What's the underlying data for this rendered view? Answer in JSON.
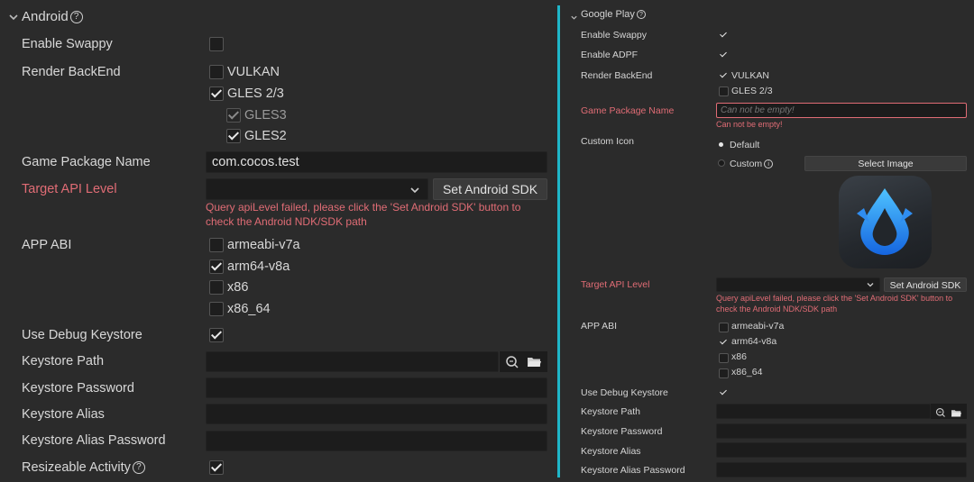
{
  "left": {
    "section_title": "Android",
    "enable_swappy_label": "Enable Swappy",
    "render_backend_label": "Render BackEnd",
    "render_options": [
      "VULKAN",
      "GLES 2/3",
      "GLES3",
      "GLES2"
    ],
    "game_package_label": "Game Package Name",
    "game_package_value": "com.cocos.test",
    "target_api_label": "Target API Level",
    "set_sdk_label": "Set Android SDK",
    "api_error_line1": "Query apiLevel failed, please click the 'Set Android SDK' button to",
    "api_error_line2": "check the Android NDK/SDK path",
    "app_abi_label": "APP ABI",
    "abi_options": [
      "armeabi-v7a",
      "arm64-v8a",
      "x86",
      "x86_64"
    ],
    "use_debug_keystore_label": "Use Debug Keystore",
    "keystore_path_label": "Keystore Path",
    "keystore_password_label": "Keystore Password",
    "keystore_alias_label": "Keystore Alias",
    "keystore_alias_password_label": "Keystore Alias Password",
    "resizeable_activity_label": "Resizeable Activity"
  },
  "right": {
    "section_title": "Google Play",
    "enable_swappy_label": "Enable Swappy",
    "enable_adpf_label": "Enable ADPF",
    "render_backend_label": "Render BackEnd",
    "render_options": [
      "VULKAN",
      "GLES 2/3"
    ],
    "game_package_label": "Game Package Name",
    "game_package_placeholder": "Can not be empty!",
    "game_package_error": "Can not be empty!",
    "custom_icon_label": "Custom Icon",
    "icon_default_label": "Default",
    "icon_custom_label": "Custom",
    "select_image_label": "Select Image",
    "target_api_label": "Target API Level",
    "set_sdk_label": "Set Android SDK",
    "api_error_line1": "Query apiLevel failed, please click the 'Set Android SDK' button to",
    "api_error_line2": "check the Android NDK/SDK path",
    "app_abi_label": "APP ABI",
    "abi_options": [
      "armeabi-v7a",
      "arm64-v8a",
      "x86",
      "x86_64"
    ],
    "use_debug_keystore_label": "Use Debug Keystore",
    "keystore_path_label": "Keystore Path",
    "keystore_password_label": "Keystore Password",
    "keystore_alias_label": "Keystore Alias",
    "keystore_alias_password_label": "Keystore Alias Password"
  },
  "icons": {
    "help": "question-circle-icon",
    "collapse": "chevron-down-icon",
    "dropdown": "chevron-down-icon",
    "search": "search-icon",
    "folder": "folder-icon",
    "app_icon": "cocos-logo-icon"
  },
  "colors": {
    "accent_divider": "#1fb6c9",
    "error": "#e06c75",
    "background": "#2b2b2b",
    "input_bg": "#1c1c1c"
  }
}
